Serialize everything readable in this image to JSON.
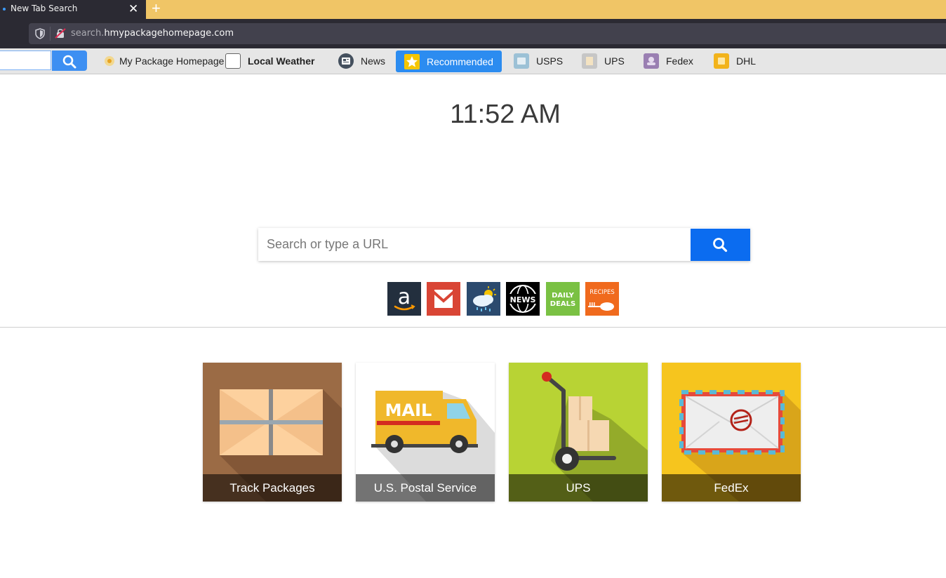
{
  "browser": {
    "tab_title": "New Tab Search",
    "tab_close": "✕",
    "new_tab": "+",
    "url_prefix": "search.",
    "url_host": "hmypackagehomepage.com"
  },
  "toolbar": {
    "items": [
      {
        "label": "My Package Homepage",
        "icon": "package-icon"
      },
      {
        "label": "Local Weather",
        "icon": "weather-icon"
      },
      {
        "label": "News",
        "icon": "news-icon"
      },
      {
        "label": "Recommended",
        "icon": "star-icon"
      },
      {
        "label": "USPS",
        "icon": "usps-icon"
      },
      {
        "label": "UPS",
        "icon": "ups-icon"
      },
      {
        "label": "Fedex",
        "icon": "fedex-icon"
      },
      {
        "label": "DHL",
        "icon": "dhl-icon"
      }
    ]
  },
  "clock": {
    "time": "11:52 AM"
  },
  "search": {
    "placeholder": "Search or type a URL"
  },
  "quick_links": [
    {
      "name": "amazon",
      "label": "a"
    },
    {
      "name": "gmail",
      "label": ""
    },
    {
      "name": "weather",
      "label": ""
    },
    {
      "name": "news",
      "label": "NEWS"
    },
    {
      "name": "daily-deals",
      "label1": "DAILY",
      "label2": "DEALS"
    },
    {
      "name": "recipes",
      "label": "RECIPES"
    }
  ],
  "tiles": [
    {
      "label": "Track Packages",
      "color": "#9b6b45"
    },
    {
      "label": "U.S. Postal Service",
      "color": "#ffffff"
    },
    {
      "label": "UPS",
      "color": "#b8d334"
    },
    {
      "label": "FedEx",
      "color": "#f6c51e"
    }
  ],
  "colors": {
    "tabstrip": "#f0c566",
    "chrome": "#2b2a33",
    "accent": "#0b6cf0",
    "recommended": "#2c8cf0"
  }
}
